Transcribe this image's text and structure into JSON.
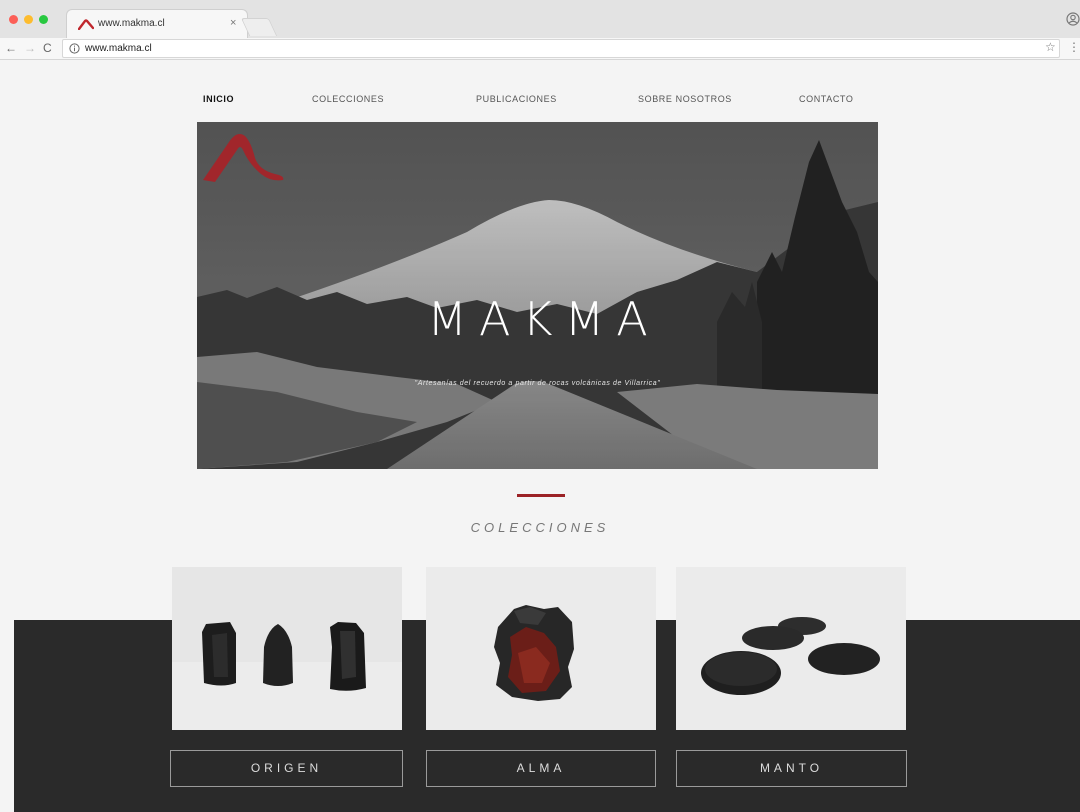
{
  "browser": {
    "tab_title": "www.makma.cl",
    "tab_close": "×",
    "url": "www.makma.cl",
    "back": "←",
    "forward": "→",
    "reload": "C",
    "star": "☆",
    "menu": "⋮"
  },
  "nav": {
    "items": [
      {
        "label": "INICIO",
        "active": true
      },
      {
        "label": "COLECCIONES",
        "active": false
      },
      {
        "label": "PUBLICACIONES",
        "active": false
      },
      {
        "label": "SOBRE NOSOTROS",
        "active": false
      },
      {
        "label": "CONTACTO",
        "active": false
      }
    ]
  },
  "hero": {
    "title": "MAKMA",
    "tagline": "\"Artesanías del recuerdo a partir de rocas volcánicas de Villarrica\""
  },
  "collections": {
    "title": "COLECCIONES",
    "items": [
      {
        "label": "ORIGEN",
        "image": "three-black-volcanic-rock-pieces"
      },
      {
        "label": "ALMA",
        "image": "red-black-volcanic-rock"
      },
      {
        "label": "MANTO",
        "image": "flat-porous-black-stones"
      }
    ]
  },
  "colors": {
    "accent": "#9b2226",
    "dark_band": "#2a2a2a",
    "page_bg": "#f4f4f4"
  }
}
